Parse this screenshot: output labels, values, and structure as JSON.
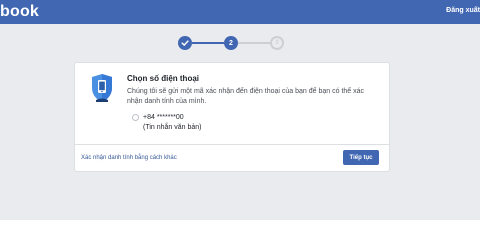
{
  "header": {
    "logo_text": "book",
    "logout_label": "Đăng xuất"
  },
  "stepper": {
    "steps": [
      {
        "state": "done",
        "icon": "check-icon"
      },
      {
        "state": "current",
        "label": "2"
      },
      {
        "state": "pending",
        "label": "3"
      }
    ]
  },
  "card": {
    "title": "Chọn số điện thoại",
    "description": "Chúng tôi sẽ gửi một mã xác nhận đến điện thoại của bạn để bạn có thể xác nhận danh tính của mình.",
    "phone_option": {
      "number": "+84 *******00",
      "method": "(Tin nhắn văn bản)"
    },
    "alt_link": "Xác nhận danh tính bằng cách khác",
    "continue_label": "Tiếp tục"
  },
  "colors": {
    "brand": "#4267b2",
    "page_bg": "#e9ebee",
    "link": "#365899"
  }
}
